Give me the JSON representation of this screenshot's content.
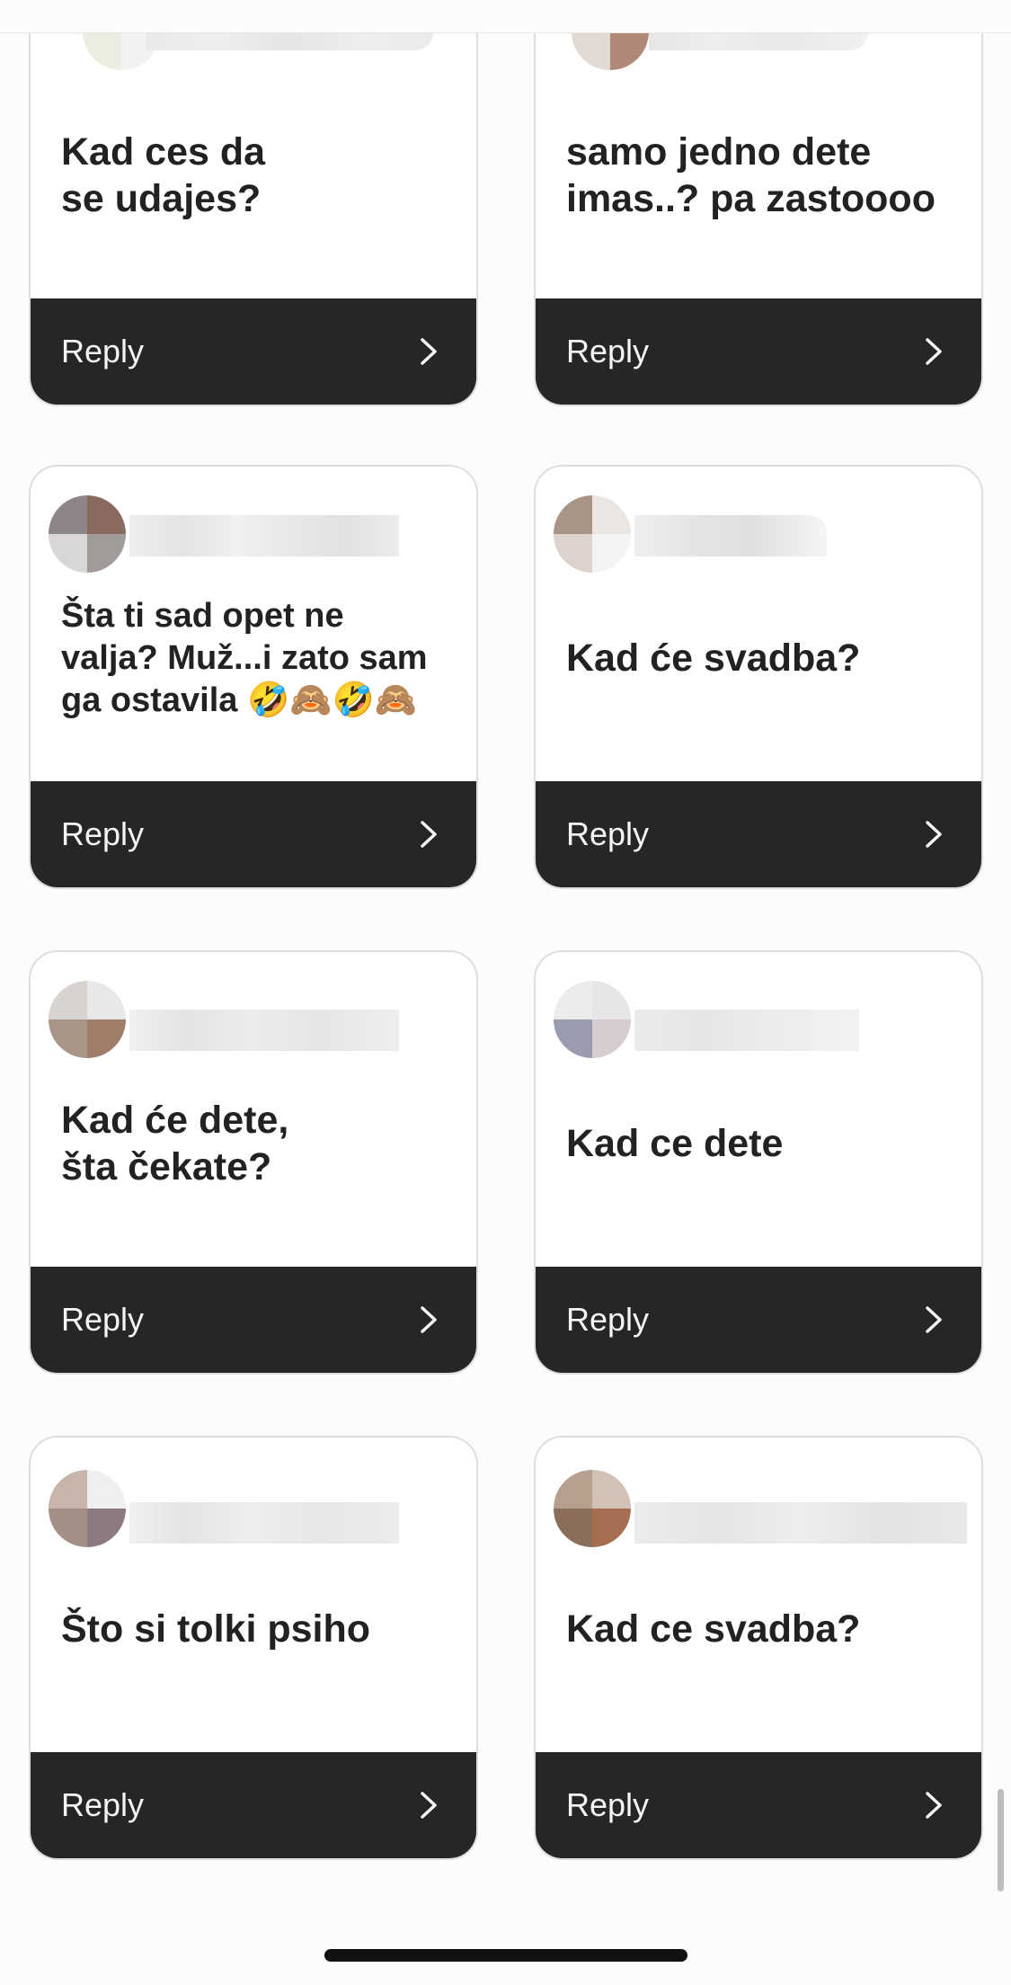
{
  "reply_label": "Reply",
  "cards": [
    {
      "question": "Kad ces da\nse udajes?"
    },
    {
      "question": "samo jedno dete\nimas..? pa zastoooo"
    },
    {
      "question": "Šta ti sad opet ne valja? Muž...i zato sam ga ostavila 🤣🙈🤣🙈"
    },
    {
      "question": "Kad će svadba?"
    },
    {
      "question": "Kad će dete,\nšta čekate?"
    },
    {
      "question": "Kad ce dete"
    },
    {
      "question": "Što si tolki psiho"
    },
    {
      "question": "Kad ce svadba?"
    }
  ],
  "icons": {
    "chevron": "chevron-right-icon",
    "avatar": "blurred-avatar"
  },
  "colors": {
    "reply_bar": "#262626",
    "card_border": "#dedede",
    "text": "#222222"
  }
}
